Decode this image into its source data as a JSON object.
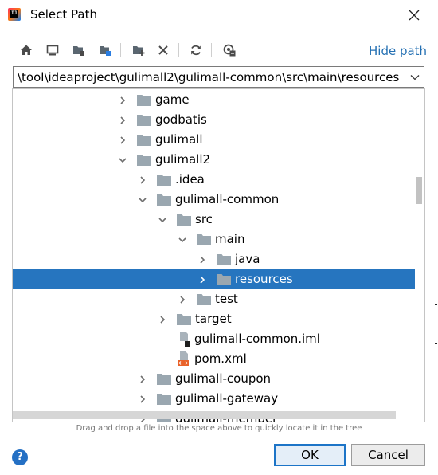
{
  "window": {
    "title": "Select Path",
    "app_icon_text": "IJ"
  },
  "toolbar": {
    "buttons": [
      {
        "name": "home-icon",
        "tooltip": "Home"
      },
      {
        "name": "desktop-icon",
        "tooltip": "Desktop"
      },
      {
        "name": "project-icon",
        "tooltip": "Project"
      },
      {
        "name": "module-icon",
        "tooltip": "Module"
      },
      {
        "name": "new-folder-icon",
        "tooltip": "New Folder"
      },
      {
        "name": "delete-icon",
        "tooltip": "Delete"
      },
      {
        "name": "refresh-icon",
        "tooltip": "Refresh"
      },
      {
        "name": "show-hidden-icon",
        "tooltip": "Show Hidden Files"
      }
    ],
    "hide_path_label": "Hide path"
  },
  "path": {
    "value": "\\tool\\ideaproject\\gulimall2\\gulimall-common\\src\\main\\resources"
  },
  "tree": {
    "rows": [
      {
        "label": "game",
        "depth": 4,
        "type": "folder",
        "expanded": false,
        "selected": false
      },
      {
        "label": "godbatis",
        "depth": 4,
        "type": "folder",
        "expanded": false,
        "selected": false
      },
      {
        "label": "gulimall",
        "depth": 4,
        "type": "folder",
        "expanded": false,
        "selected": false
      },
      {
        "label": "gulimall2",
        "depth": 4,
        "type": "folder",
        "expanded": true,
        "selected": false
      },
      {
        "label": ".idea",
        "depth": 5,
        "type": "folder",
        "expanded": false,
        "selected": false
      },
      {
        "label": "gulimall-common",
        "depth": 5,
        "type": "folder",
        "expanded": true,
        "selected": false
      },
      {
        "label": "src",
        "depth": 6,
        "type": "folder",
        "expanded": true,
        "selected": false
      },
      {
        "label": "main",
        "depth": 7,
        "type": "folder",
        "expanded": true,
        "selected": false
      },
      {
        "label": "java",
        "depth": 8,
        "type": "folder",
        "expanded": false,
        "selected": false
      },
      {
        "label": "resources",
        "depth": 8,
        "type": "folder",
        "expanded": false,
        "selected": true
      },
      {
        "label": "test",
        "depth": 7,
        "type": "folder",
        "expanded": false,
        "selected": false
      },
      {
        "label": "target",
        "depth": 6,
        "type": "folder",
        "expanded": false,
        "selected": false
      },
      {
        "label": "gulimall-common.iml",
        "depth": 6,
        "type": "iml",
        "expanded": false,
        "selected": false
      },
      {
        "label": "pom.xml",
        "depth": 6,
        "type": "xml",
        "expanded": false,
        "selected": false
      },
      {
        "label": "gulimall-coupon",
        "depth": 5,
        "type": "folder",
        "expanded": false,
        "selected": false
      },
      {
        "label": "gulimall-gateway",
        "depth": 5,
        "type": "folder",
        "expanded": false,
        "selected": false
      },
      {
        "label": "gulimall-member",
        "depth": 5,
        "type": "folder",
        "expanded": false,
        "selected": false
      }
    ]
  },
  "hint": "Drag and drop a file into the space above to quickly locate it in the tree",
  "buttons": {
    "help": "?",
    "ok": "OK",
    "cancel": "Cancel"
  },
  "colors": {
    "accent": "#2470b3",
    "selection": "#2675bf",
    "folder": "#9aa7b0"
  }
}
